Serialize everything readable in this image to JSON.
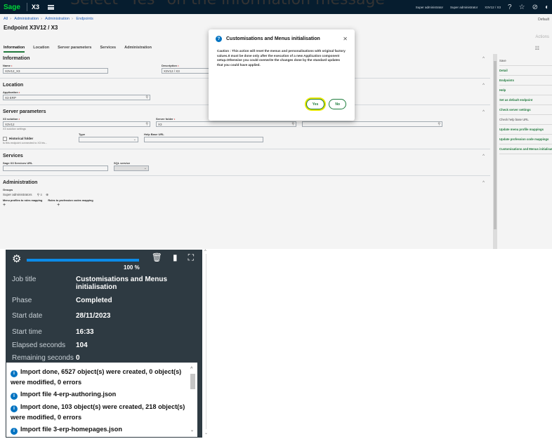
{
  "caption": "Select \"Yes\" on the information message",
  "topbar": {
    "logo": "Sage",
    "product": "X3",
    "user_profile": "Super administrator",
    "user_role": "Super administrator",
    "endpoint": "X3V12 / X3",
    "icons": [
      "help-icon",
      "star-icon",
      "compass-icon",
      "user-icon"
    ]
  },
  "breadcrumb": [
    "All",
    "Administration",
    "Administration",
    "Endpoints"
  ],
  "default_label": "Default",
  "page_title": "Endpoint X3V12 / X3",
  "actions_label": "Actions",
  "tabs": [
    "Information",
    "Location",
    "Server parameters",
    "Services",
    "Administration"
  ],
  "sections": {
    "information": {
      "title": "Information",
      "name_label": "Name",
      "name_value": "X3V12_X3",
      "description_label": "Description",
      "description_value": "X3V12 / X3"
    },
    "location": {
      "title": "Location",
      "application_label": "Application",
      "application_value": "X3 ERP"
    },
    "server": {
      "title": "Server parameters",
      "solution_label": "X3 solution",
      "solution_value": "X3V12",
      "solution_note": "X3 solution settings",
      "folder_label": "Server folder",
      "folder_value": "X3",
      "ref_label": "Reference folder",
      "ref_value": "",
      "type_label": "Type",
      "helpurl_label": "Help Base URL",
      "historical_label": "Historical folder",
      "historical_note": "Is this endpoint connected to X3 his..."
    },
    "services": {
      "title": "Services",
      "services_url_label": "Sage X3 Services URL",
      "sql_label": "SQL service"
    },
    "administration": {
      "title": "Administration",
      "groups_label": "Groups",
      "groups_value": "Super administrators",
      "menu_map_label": "Menu profiles to roles mapping",
      "roles_map_label": "Roles to profession codes mapping"
    }
  },
  "right_panel": [
    {
      "label": "Save",
      "style": "plain"
    },
    {
      "label": "Detail",
      "style": "link"
    },
    {
      "label": "Endpoints",
      "style": "link"
    },
    {
      "label": "Help",
      "style": "link"
    },
    {
      "label": "Set as default endpoint",
      "style": "link"
    },
    {
      "label": "Check server settings",
      "style": "link"
    },
    {
      "label": "Check help base URL",
      "style": "plain"
    },
    {
      "label": "Update menu profile mappings",
      "style": "link"
    },
    {
      "label": "Update profession code mappings",
      "style": "link"
    },
    {
      "label": "Customisations and Menus initialisation",
      "style": "link"
    }
  ],
  "dialog": {
    "title": "Customisations and Menus initialisation",
    "message": "Caution : This action will reset the menus and personalisations with original factory values.It must be done only after the execution of a new Application component setup.Otherwise you could overwrite the changes done by the standard updates that you could have applied.",
    "yes_label": "Yes",
    "no_label": "No"
  },
  "job": {
    "progress_percent": 100,
    "progress_label": "100 %",
    "fields": [
      {
        "key": "Job title",
        "value": "Customisations and Menus initialisation"
      },
      {
        "key": "Phase",
        "value": "Completed"
      },
      {
        "key": "Start date",
        "value": "28/11/2023"
      },
      {
        "key": "Start time",
        "value": "16:33"
      },
      {
        "key": "Elapsed seconds",
        "value": "104"
      },
      {
        "key": "Remaining seconds",
        "value": "0"
      }
    ],
    "log": [
      "Import done, 6527 object(s) were created, 0 object(s) were modified, 0 errors",
      "Import file 4-erp-authoring.json",
      "Import done, 103 object(s) were created, 218 object(s) were modified, 0 errors",
      "Import file 3-erp-homepages.json"
    ]
  },
  "colors": {
    "topbar": "#061d2f",
    "accent_green": "#1e7d3c",
    "info_blue": "#0073c2",
    "progress_blue": "#0c8be8",
    "job_panel": "#2e3a42",
    "yes_highlight": "#e4e600"
  }
}
